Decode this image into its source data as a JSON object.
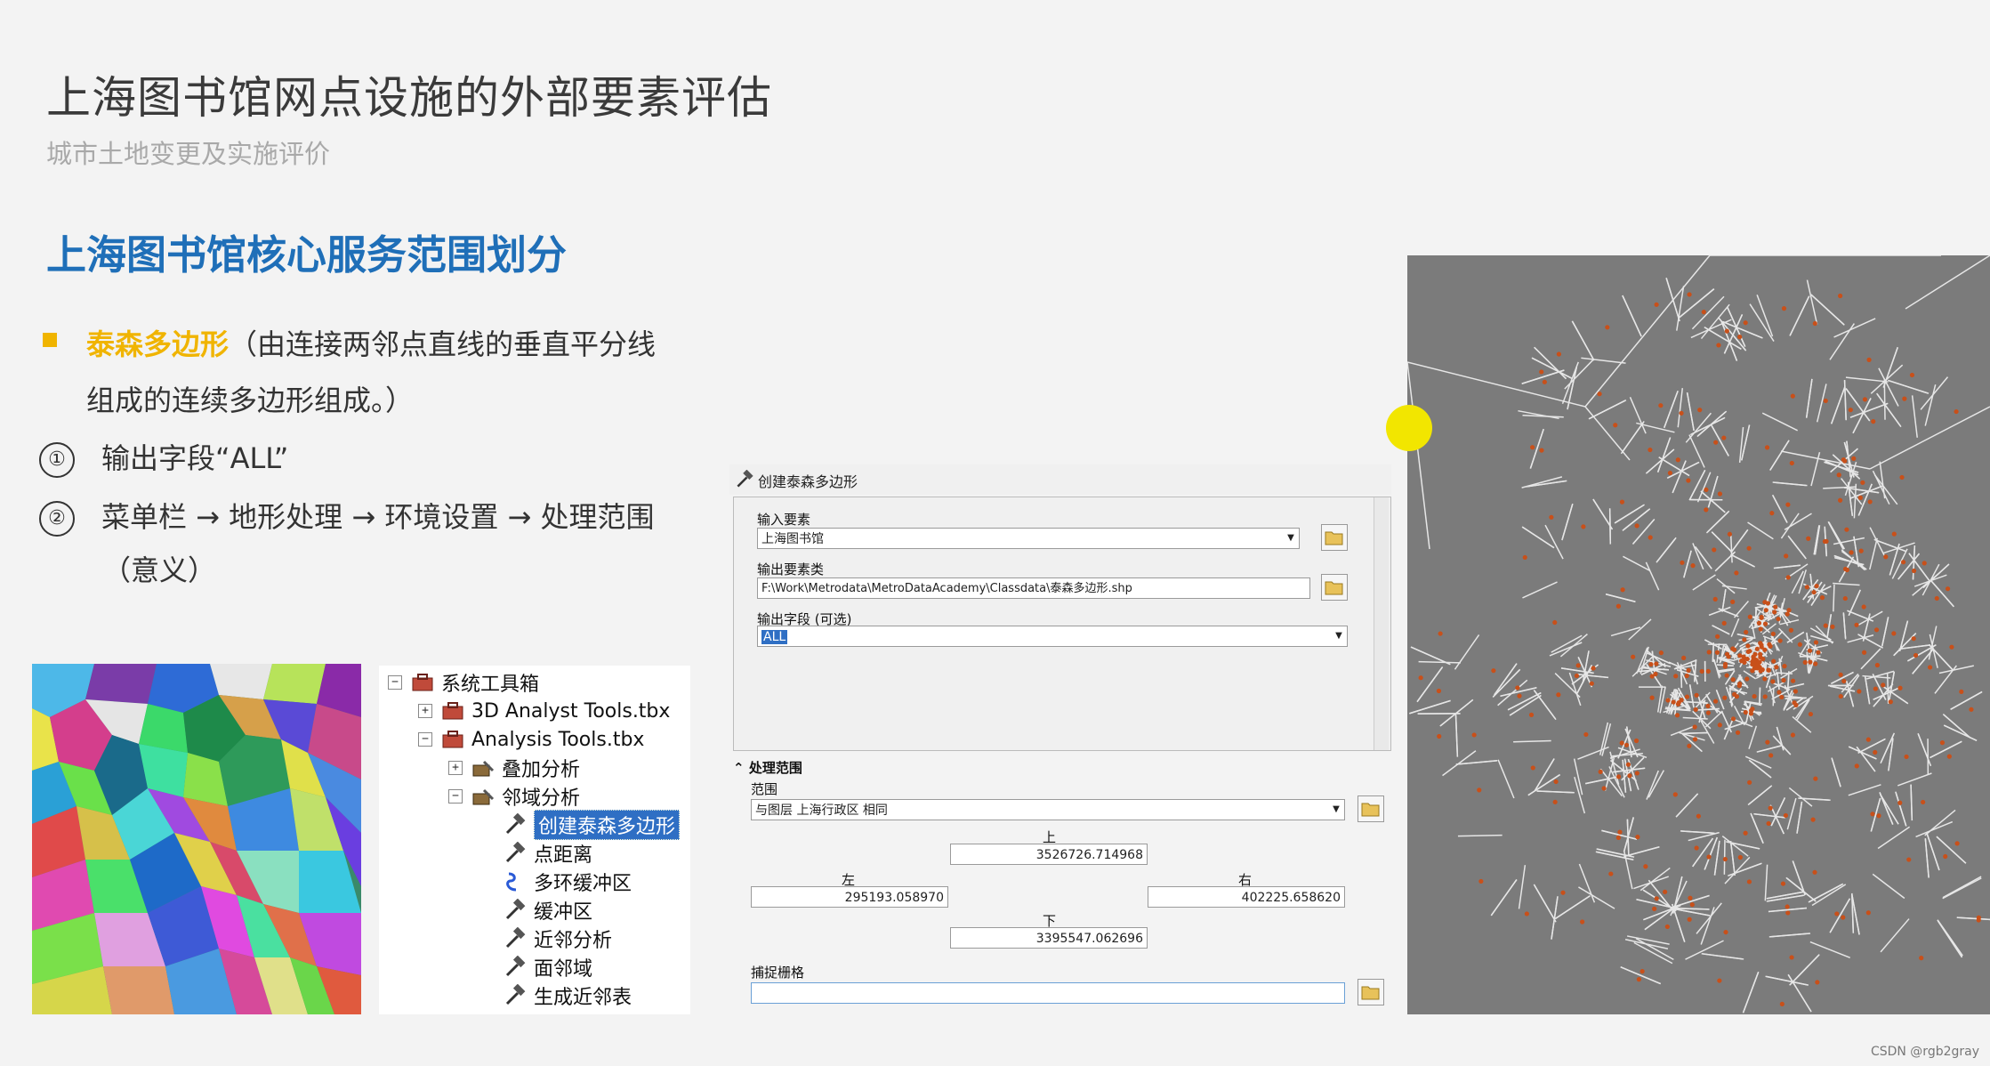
{
  "slide": {
    "title": "上海图书馆网点设施的外部要素评估",
    "subtitle": "城市土地变更及实施评价",
    "section_heading": "上海图书馆核心服务范围划分",
    "bullet1_highlight": "泰森多边形",
    "bullet1_rest": "（由连接两邻点直线的垂直平分线",
    "bullet1_cont": "组成的连续多边形组成。）",
    "item1_num": "①",
    "item1_text": "输出字段“ALL”",
    "item2_num": "②",
    "item2_text": "菜单栏 → 地形处理 → 环境设置 → 处理范围",
    "item2_cont": "（意义）"
  },
  "toolbox": {
    "root": "系统工具箱",
    "items": [
      {
        "label": "3D Analyst Tools.tbx",
        "expander": "+"
      },
      {
        "label": "Analysis Tools.tbx",
        "expander": "−"
      },
      {
        "label": "叠加分析",
        "expander": "+"
      },
      {
        "label": "邻域分析",
        "expander": "−"
      }
    ],
    "tools": [
      "创建泰森多边形",
      "点距离",
      "多环缓冲区",
      "缓冲区",
      "近邻分析",
      "面邻域",
      "生成近邻表"
    ],
    "root_expander": "−"
  },
  "dialog": {
    "title": "创建泰森多边形",
    "input_features_label": "输入要素",
    "input_features_value": "上海图书馆",
    "output_class_label": "输出要素类",
    "output_class_value": "F:\\Work\\Metrodata\\MetroDataAcademy\\Classdata\\泰森多边形.shp",
    "output_fields_label": "输出字段 (可选)",
    "output_fields_value": "ALL",
    "env_section": "处理范围",
    "extent_label": "范围",
    "extent_value": "与图层 上海行政区 相同",
    "top_label": "上",
    "top_value": "3526726.714968",
    "left_label": "左",
    "left_value": "295193.058970",
    "right_label": "右",
    "right_value": "402225.658620",
    "bottom_label": "下",
    "bottom_value": "3395547.062696",
    "snap_label": "捕捉栅格"
  },
  "footer": {
    "credit": "CSDN @rgb2gray"
  },
  "colors": {
    "accent_blue": "#1f6fb8",
    "highlight_yellow": "#f0b400",
    "map_bg": "#7b7b7b",
    "map_point": "#c8501a"
  }
}
